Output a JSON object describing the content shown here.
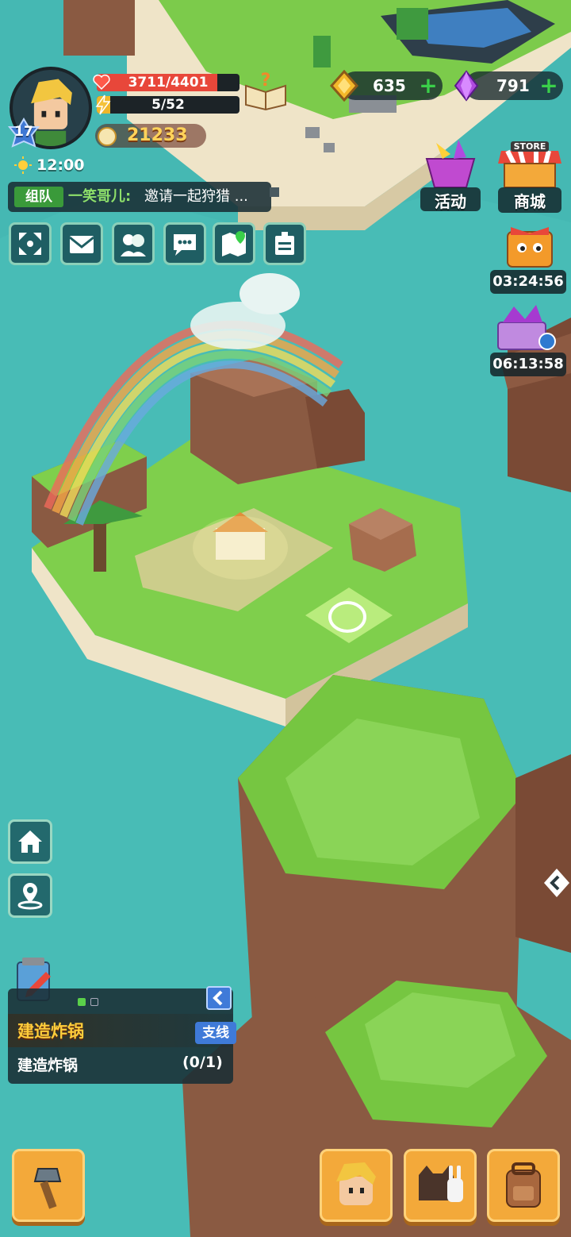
{
  "player": {
    "level": "17",
    "hp": "3711/4401",
    "hp_fraction": 0.843,
    "energy": "5/52",
    "energy_fraction": 0.096,
    "power": "21233",
    "time": "12:00"
  },
  "currencies": {
    "gold": "635",
    "gems": "791"
  },
  "shortcuts": {
    "events_label": "活动",
    "store_badge": "STORE",
    "store_label": "商城"
  },
  "timers": {
    "box_timer": "03:24:56",
    "gift_timer": "06:13:58"
  },
  "chat": {
    "channel": "组队",
    "sender": "一笑哥儿:",
    "message": "邀请一起狩猎 ..."
  },
  "quest": {
    "title": "建造炸锅",
    "tag": "支线",
    "task": "建造炸锅",
    "progress": "(0/1)"
  },
  "icons": {
    "menu": [
      "fullscreen-icon",
      "mail-icon",
      "friends-icon",
      "chat-icon",
      "map-icon",
      "notice-icon"
    ],
    "side": [
      "home-icon",
      "location-pin-icon"
    ],
    "bottom": [
      "build-hammer-icon",
      "character-icon",
      "pets-icon",
      "backpack-icon"
    ]
  },
  "colors": {
    "hp": "#e8473a",
    "energy": "#f0b62a",
    "water": "#3fb3b0",
    "grass": "#7fcf4c",
    "accent_green": "#3ad04a",
    "button_orange": "#f3a93a"
  }
}
